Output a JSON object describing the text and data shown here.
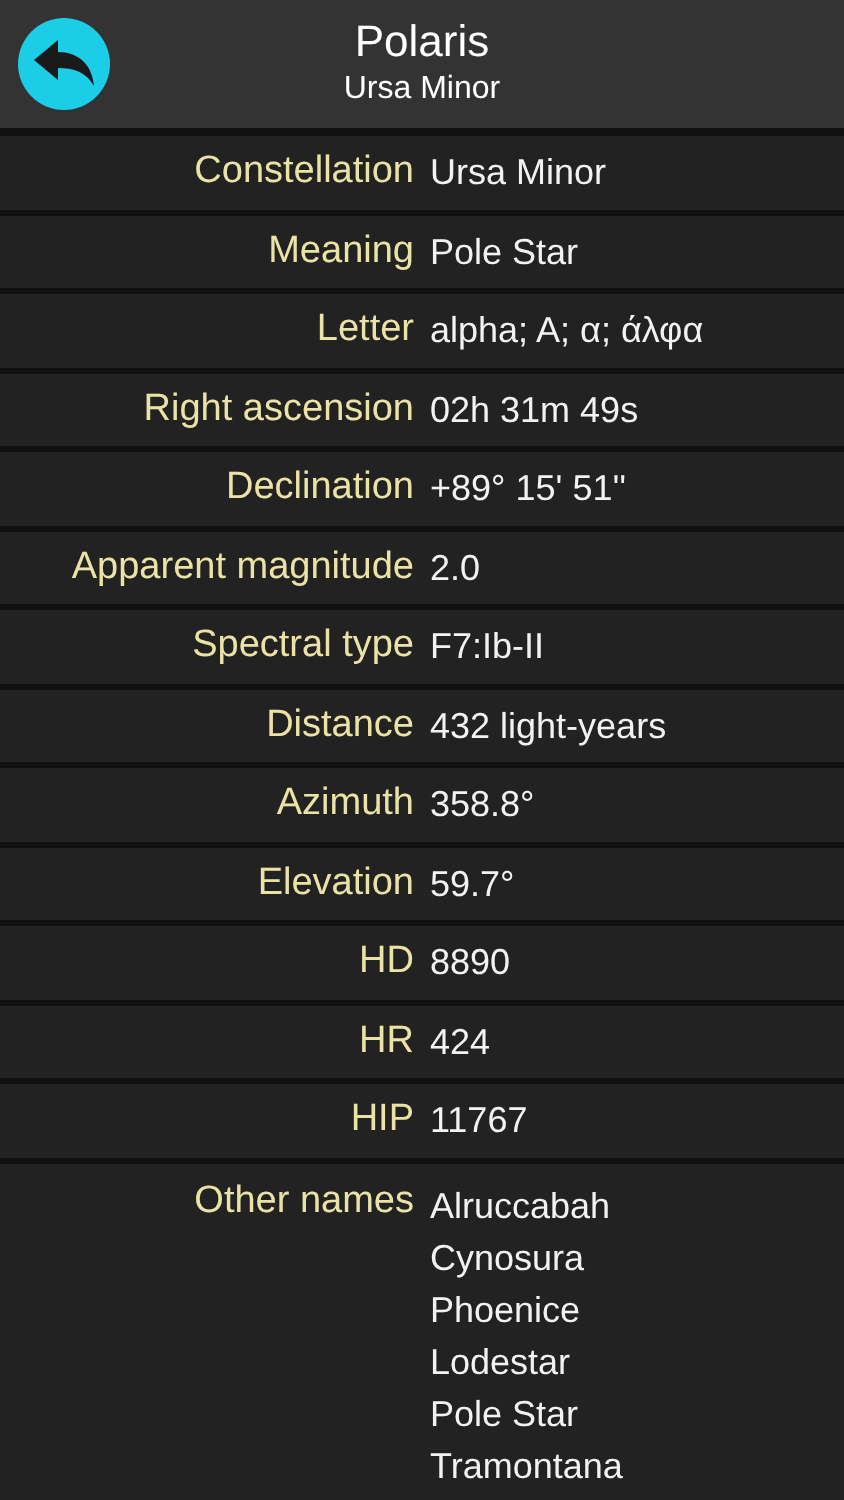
{
  "header": {
    "title": "Polaris",
    "subtitle": "Ursa Minor"
  },
  "rows": [
    {
      "label": "Constellation",
      "values": [
        "Ursa Minor"
      ]
    },
    {
      "label": "Meaning",
      "values": [
        "Pole Star"
      ]
    },
    {
      "label": "Letter",
      "values": [
        "alpha; A; α; άλφα"
      ]
    },
    {
      "label": "Right ascension",
      "values": [
        "02h 31m 49s"
      ]
    },
    {
      "label": "Declination",
      "values": [
        "+89° 15' 51''"
      ]
    },
    {
      "label": "Apparent magnitude",
      "values": [
        "2.0"
      ]
    },
    {
      "label": "Spectral type",
      "values": [
        "F7:Ib-II"
      ]
    },
    {
      "label": "Distance",
      "values": [
        "432 light-years"
      ]
    },
    {
      "label": "Azimuth",
      "values": [
        "358.8°"
      ]
    },
    {
      "label": "Elevation",
      "values": [
        "59.7°"
      ]
    },
    {
      "label": "HD",
      "values": [
        "8890"
      ]
    },
    {
      "label": "HR",
      "values": [
        "424"
      ]
    },
    {
      "label": "HIP",
      "values": [
        "11767"
      ]
    },
    {
      "label": "Other names",
      "values": [
        "Alruccabah",
        "Cynosura",
        "Phoenice",
        "Lodestar",
        "Pole Star",
        "Tramontana"
      ]
    }
  ]
}
